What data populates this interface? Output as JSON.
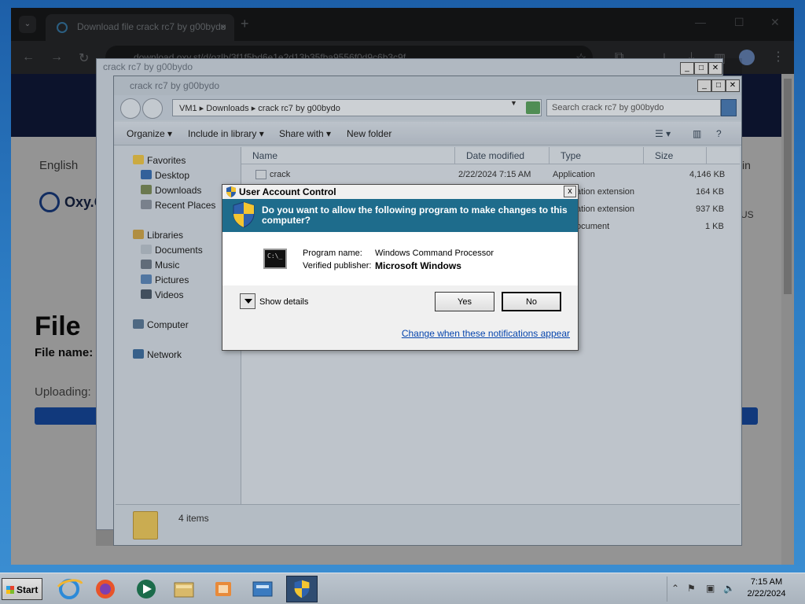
{
  "browser": {
    "tab_title": "Download file crack rc7 by g00bydo",
    "close_symbol": "×",
    "newtab_symbol": "+",
    "url": "download.oxy.st/d/ozlb/3f1f5bd6e1e2d13b35fba9556f0d9c6b3c9f",
    "page": {
      "language": "English",
      "logo_text": "Oxy.C",
      "file_heading": "File",
      "file_name_label": "File name:",
      "uploading_label": "Uploading:",
      "signin_fragment": "in",
      "region_fragment": "US"
    }
  },
  "explorer_back": {
    "title": "crack rc7 by g00bydo"
  },
  "explorer": {
    "title": "crack rc7 by g00bydo",
    "breadcrumb": "VM1  ▸  Downloads  ▸  crack rc7 by g00bydo",
    "search_placeholder": "Search crack rc7 by g00bydo",
    "commands": {
      "organize": "Organize ▾",
      "include_in_library": "Include in library ▾",
      "share_with": "Share with ▾",
      "new_folder": "New folder"
    },
    "nav": {
      "favorites": "Favorites",
      "desktop": "Desktop",
      "downloads": "Downloads",
      "recent_places": "Recent Places",
      "libraries": "Libraries",
      "documents": "Documents",
      "music": "Music",
      "pictures": "Pictures",
      "videos": "Videos",
      "computer": "Computer",
      "network": "Network"
    },
    "columns": {
      "name": "Name",
      "date": "Date modified",
      "type": "Type",
      "size": "Size"
    },
    "files": [
      {
        "name": "crack",
        "date": "2/22/2024 7:15 AM",
        "type": "Application",
        "size": "4,146 KB"
      },
      {
        "name": "",
        "date": "",
        "type": "ation extension",
        "size": "164 KB"
      },
      {
        "name": "",
        "date": "",
        "type": "ation extension",
        "size": "937 KB"
      },
      {
        "name": "",
        "date": "",
        "type": "ocument",
        "size": "1 KB"
      }
    ],
    "status": "4 items"
  },
  "uac": {
    "title": "User Account Control",
    "question": "Do you want to allow the following program to make changes to this computer?",
    "program_label": "Program name:",
    "program_value": "Windows Command Processor",
    "publisher_label": "Verified publisher:",
    "publisher_value": "Microsoft Windows",
    "show_details": "Show details",
    "yes": "Yes",
    "no": "No",
    "change_link": "Change when these notifications appear",
    "close_symbol": "x",
    "cmd_icon_text": "C:\\_"
  },
  "taskbar": {
    "start": "Start",
    "time": "7:15 AM",
    "date": "2/22/2024"
  },
  "colors": {
    "uac_banner": "#1e6c8c",
    "link": "#0645ad",
    "progress": "#1e63d6"
  }
}
